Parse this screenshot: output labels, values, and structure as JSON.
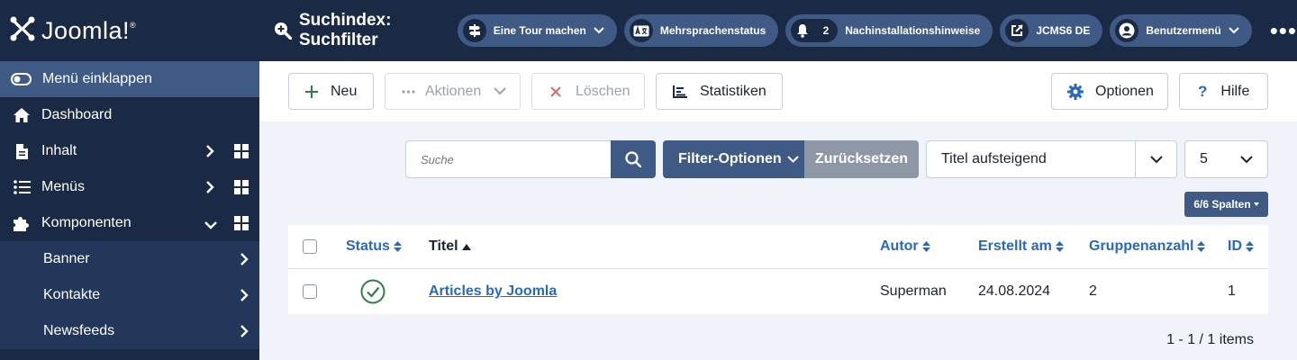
{
  "app": {
    "logo_text": "Joomla!",
    "logo_mark": "®"
  },
  "sidebar": {
    "collapse_label": "Menü einklappen",
    "items": [
      {
        "label": "Dashboard",
        "icon": "home-icon"
      },
      {
        "label": "Inhalt",
        "icon": "file-icon"
      },
      {
        "label": "Menüs",
        "icon": "list-icon"
      },
      {
        "label": "Komponenten",
        "icon": "puzzle-icon"
      }
    ],
    "subitems": [
      {
        "label": "Banner"
      },
      {
        "label": "Kontakte"
      },
      {
        "label": "Newsfeeds"
      }
    ]
  },
  "header": {
    "title": "Suchindex: Suchfilter",
    "tour": "Eine Tour machen",
    "multilang": "Mehrsprachenstatus",
    "notifications_count": "2",
    "postinstall": "Nachinstallationshinweise",
    "site": "JCMS6 DE",
    "usermenu": "Benutzermenü",
    "more": "•••"
  },
  "toolbar": {
    "new": "Neu",
    "actions": "Aktionen",
    "delete": "Löschen",
    "statistics": "Statistiken",
    "options": "Optionen",
    "help": "Hilfe"
  },
  "filters": {
    "search_placeholder": "Suche",
    "filter_options": "Filter-Optionen",
    "reset": "Zurücksetzen",
    "ordering": "Titel aufsteigend",
    "limit": "5",
    "columns": "6/6 Spalten"
  },
  "table": {
    "headers": {
      "status": "Status",
      "title": "Titel",
      "author": "Autor",
      "created": "Erstellt am",
      "groups": "Gruppenanzahl",
      "id": "ID"
    },
    "rows": [
      {
        "status": "published",
        "title": "Articles by Joomla",
        "author": "Superman",
        "created": "24.08.2024",
        "groups": "2",
        "id": "1"
      }
    ]
  },
  "pagination": {
    "summary": "1 - 1 / 1 items"
  },
  "colors": {
    "sidebar_bg": "#1b2a44",
    "accent": "#3e5a85",
    "link": "#2a69b8",
    "success": "#2f7d4a"
  }
}
